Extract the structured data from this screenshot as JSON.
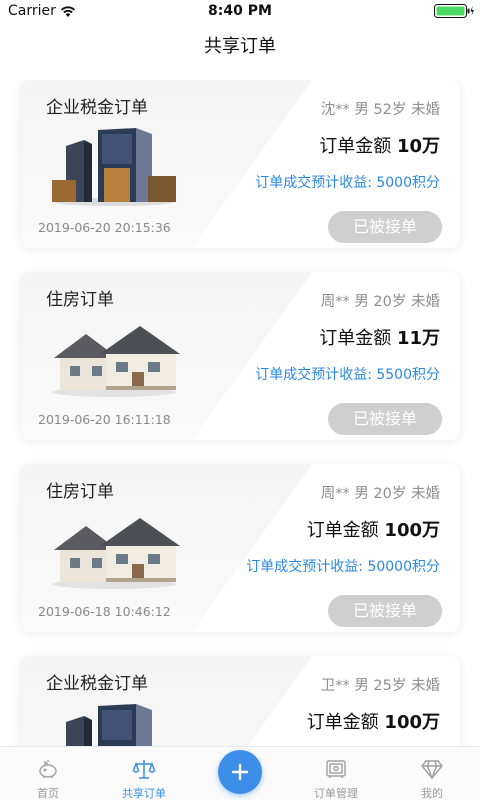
{
  "status_bar": {
    "carrier": "Carrier",
    "time": "8:40 PM"
  },
  "nav": {
    "title": "共享订单"
  },
  "orders": [
    {
      "title": "企业税金订单",
      "image": "office-building",
      "customer": "沈** 男 52岁 未婚",
      "amount_label": "订单金额",
      "amount_value": "10万",
      "income": "订单成交预计收益: 5000积分",
      "time": "2019-06-20 20:15:36",
      "status": "已被接单"
    },
    {
      "title": "住房订单",
      "image": "house",
      "customer": "周** 男 20岁 未婚",
      "amount_label": "订单金额",
      "amount_value": "11万",
      "income": "订单成交预计收益: 5500积分",
      "time": "2019-06-20 16:11:18",
      "status": "已被接单"
    },
    {
      "title": "住房订单",
      "image": "house",
      "customer": "周** 男 20岁 未婚",
      "amount_label": "订单金额",
      "amount_value": "100万",
      "income": "订单成交预计收益: 50000积分",
      "time": "2019-06-18 10:46:12",
      "status": "已被接单"
    },
    {
      "title": "企业税金订单",
      "image": "office-building",
      "customer": "卫** 男 25岁 未婚",
      "amount_label": "订单金额",
      "amount_value": "100万",
      "income": "",
      "time": "",
      "status": ""
    }
  ],
  "tabbar": {
    "active": 1,
    "items": [
      {
        "label": "首页",
        "icon": "piggy-bank-icon"
      },
      {
        "label": "共享订单",
        "icon": "scales-icon"
      },
      {
        "label": "",
        "icon": "plus-icon"
      },
      {
        "label": "订单管理",
        "icon": "safe-icon"
      },
      {
        "label": "我的",
        "icon": "diamond-icon"
      }
    ]
  },
  "colors": {
    "accent": "#3d8ee8",
    "income_blue": "#2b8ae6",
    "status_grey": "#cfcfcf"
  }
}
